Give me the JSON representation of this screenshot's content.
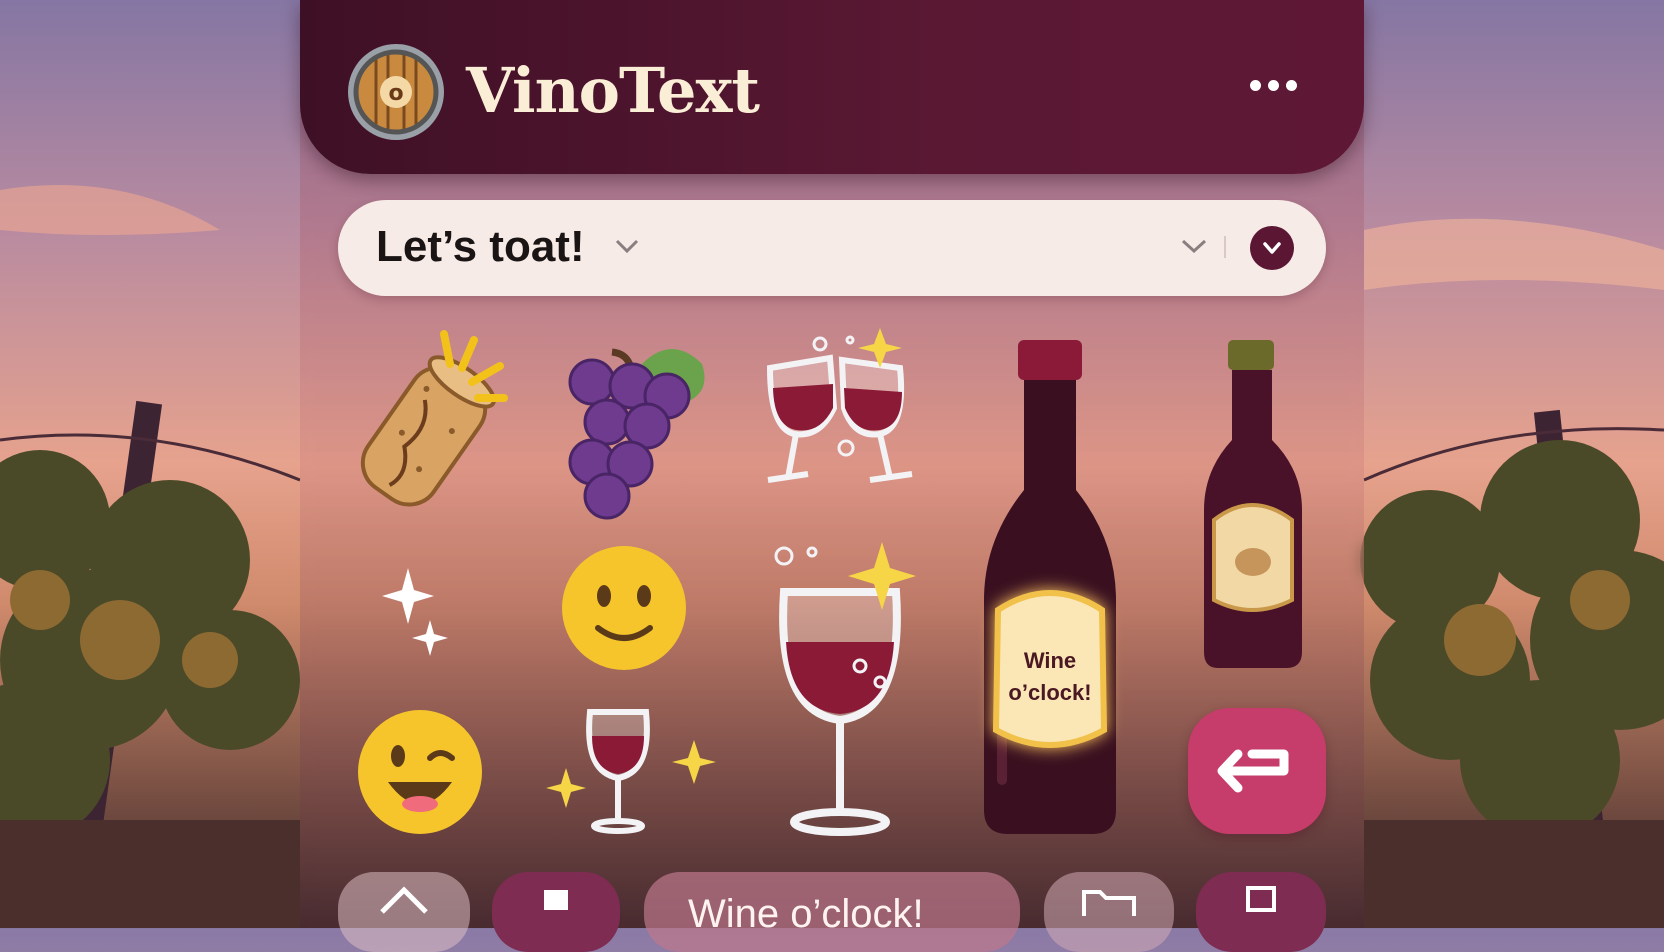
{
  "app": {
    "title": "VinoText",
    "logo_letter": "o"
  },
  "input": {
    "text": "Let’s toat!"
  },
  "bottom_bar": {
    "suggestion": "Wine o’clock!"
  },
  "stickers": {
    "bottle_label": [
      "Wine",
      "o’clock!"
    ]
  },
  "colors": {
    "header": "#4e1430",
    "accent": "#c63c6a",
    "wine": "#7a1a30",
    "cream": "#fbeed6"
  },
  "icons": [
    "more-icon",
    "chevron-down-icon",
    "send-icon",
    "enter-icon",
    "home-icon",
    "folder-icon"
  ]
}
